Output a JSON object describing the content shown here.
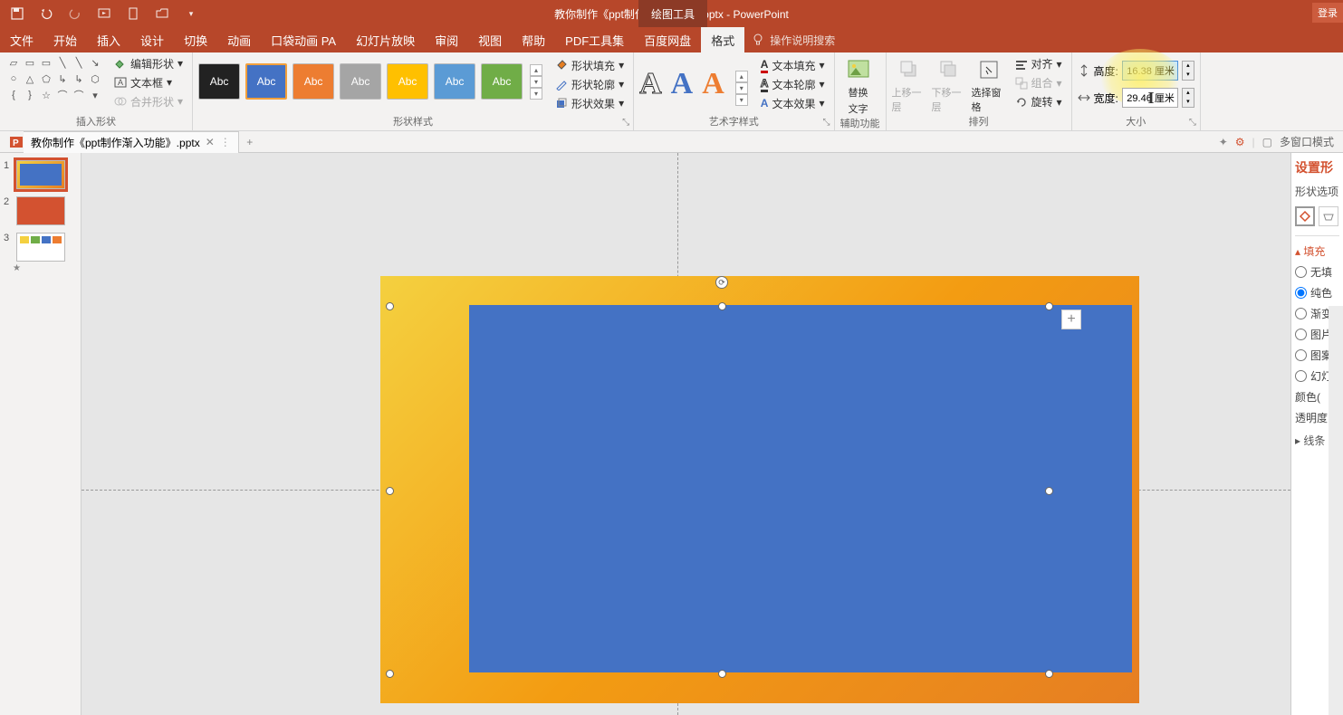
{
  "titlebar": {
    "doc_title": "教你制作《ppt制作渐入功能》.pptx  -  PowerPoint",
    "context_tool": "绘图工具",
    "login": "登录"
  },
  "tabs": {
    "file": "文件",
    "home": "开始",
    "insert": "插入",
    "design": "设计",
    "transitions": "切换",
    "animations": "动画",
    "pocket": "口袋动画 PA",
    "slideshow": "幻灯片放映",
    "review": "审阅",
    "view": "视图",
    "help": "帮助",
    "pdf": "PDF工具集",
    "baidu": "百度网盘",
    "format": "格式",
    "tell_me": "操作说明搜索"
  },
  "groups": {
    "insert_shapes": "插入形状",
    "shape_styles": "形状样式",
    "wordart_styles": "艺术字样式",
    "accessibility": "辅助功能",
    "arrange": "排列",
    "size": "大小",
    "edit_shape": "编辑形状",
    "text_box": "文本框",
    "merge_shapes": "合并形状",
    "shape_fill": "形状填充",
    "shape_outline": "形状轮廓",
    "shape_effects": "形状效果",
    "text_fill": "文本填充",
    "text_outline": "文本轮廓",
    "text_effects": "文本效果",
    "alt_text1": "替换",
    "alt_text2": "文字",
    "bring_fwd": "上移一层",
    "send_back": "下移一层",
    "selection_pane": "选择窗格",
    "align": "对齐",
    "group": "组合",
    "rotate": "旋转",
    "height_label": "高度:",
    "width_label": "宽度:",
    "height_val": "16.38 厘米",
    "width_val": "29.46 厘米",
    "swatch_label": "Abc"
  },
  "doctab": {
    "name": "教你制作《ppt制作渐入功能》.pptx",
    "multi_window": "多窗口模式"
  },
  "thumbs": [
    "1",
    "2",
    "3"
  ],
  "pane": {
    "title": "设置形",
    "options": "形状选项",
    "fill_section": "填充",
    "no_fill": "无填",
    "solid": "纯色",
    "gradient": "渐变",
    "picture": "图片",
    "pattern": "图案",
    "slide_bg": "幻灯",
    "color": "颜色(",
    "transparency": "透明度",
    "line_section": "线条"
  }
}
